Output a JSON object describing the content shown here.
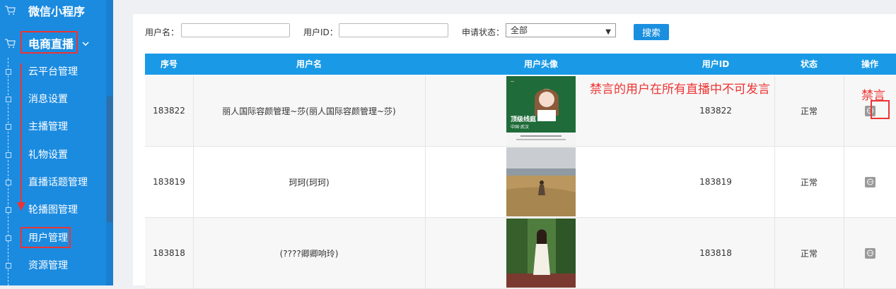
{
  "sidebar": {
    "menu": [
      {
        "label": "微信小程序"
      },
      {
        "label": "电商直播"
      }
    ],
    "items": [
      {
        "label": "云平台管理"
      },
      {
        "label": "消息设置"
      },
      {
        "label": "主播管理"
      },
      {
        "label": "礼物设置"
      },
      {
        "label": "直播话题管理"
      },
      {
        "label": "轮播图管理"
      },
      {
        "label": "用户管理"
      },
      {
        "label": "资源管理"
      }
    ]
  },
  "filters": {
    "username_label": "用户名：",
    "username_value": "",
    "userid_label": "用户ID：",
    "userid_value": "",
    "status_label": "申请状态：",
    "status_selected": "全部",
    "search_label": "搜索"
  },
  "table": {
    "columns": [
      "序号",
      "用户名",
      "用户头像",
      "用户ID",
      "状态",
      "操作"
    ],
    "rows": [
      {
        "seq": "183822",
        "name": "丽人国际容颜管理~莎(丽人国际容颜管理~莎)",
        "uid": "183822",
        "status": "正常"
      },
      {
        "seq": "183819",
        "name": "珂珂(珂珂)",
        "uid": "183819",
        "status": "正常"
      },
      {
        "seq": "183818",
        "name": "(????卿卿响玲)",
        "uid": "183818",
        "status": "正常"
      }
    ]
  },
  "annotations": {
    "mute_note": "禁言的用户在所有直播中不可发言",
    "mute_label": "禁言"
  },
  "poster": {
    "headline": "顶级线庭",
    "tagline": "中国·武汉"
  },
  "colors": {
    "sidebar": "#1b8be0",
    "header": "#1a9ae6",
    "annotation": "#e33333"
  }
}
